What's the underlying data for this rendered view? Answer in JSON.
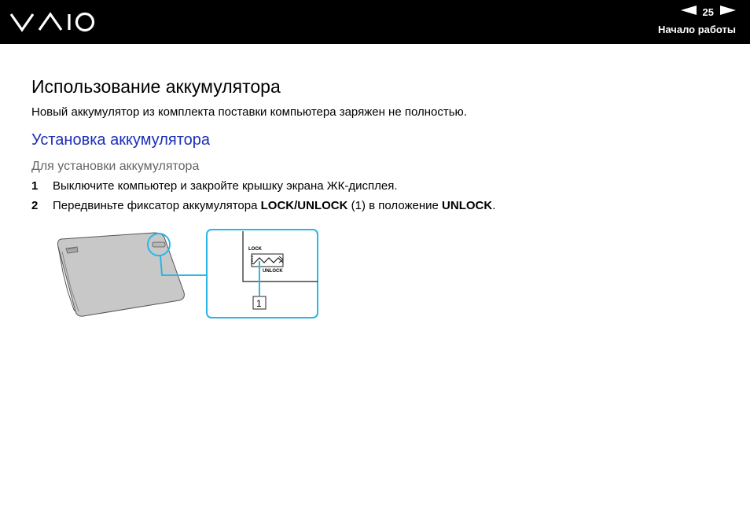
{
  "header": {
    "brand": "VAIO",
    "page_number": "25",
    "section": "Начало работы"
  },
  "content": {
    "title": "Использование аккумулятора",
    "intro": "Новый аккумулятор из комплекта поставки компьютера заряжен не полностью.",
    "subtitle": "Установка аккумулятора",
    "procedure_title": "Для установки аккумулятора",
    "steps": [
      {
        "num": "1",
        "text": "Выключите компьютер и закройте крышку экрана ЖК-дисплея."
      },
      {
        "num": "2",
        "parts": [
          "Передвиньте фиксатор аккумулятора ",
          "LOCK/UNLOCK",
          " (1) в положение ",
          "UNLOCK",
          "."
        ]
      }
    ]
  },
  "figure": {
    "lock_label": "LOCK",
    "unlock_label": "UNLOCK",
    "callout": "1"
  },
  "colors": {
    "header_bg": "#000000",
    "subtitle_blue": "#1c2fb8",
    "callout_cyan": "#2bb6e6",
    "battery_gray": "#c8c8c8"
  }
}
